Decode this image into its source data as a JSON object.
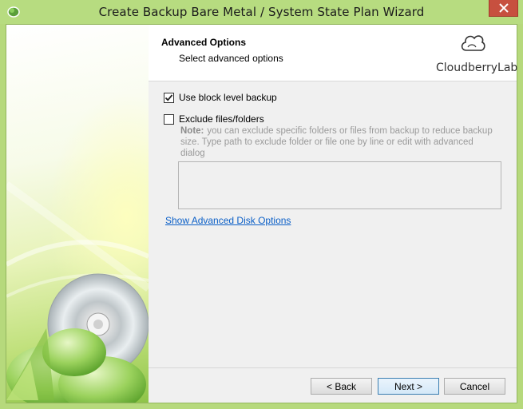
{
  "window": {
    "title": "Create Backup Bare Metal / System State Plan Wizard"
  },
  "header": {
    "title": "Advanced Options",
    "subtitle": "Select advanced options",
    "logo_text": "CloudberryLab"
  },
  "options": {
    "block_level": {
      "label": "Use block level backup",
      "checked": true
    },
    "exclude": {
      "label": "Exclude files/folders",
      "checked": false
    }
  },
  "note": {
    "label": "Note:",
    "text": "you can exclude specific folders or files from backup to reduce backup size. Type path to exclude folder or file one by line or edit with advanced dialog"
  },
  "links": {
    "advanced_disk": "Show Advanced Disk Options"
  },
  "buttons": {
    "back": "< Back",
    "next": "Next >",
    "cancel": "Cancel"
  },
  "colors": {
    "titlebar": "#b7dc80",
    "close": "#c7503f",
    "link": "#0b5fc7"
  }
}
